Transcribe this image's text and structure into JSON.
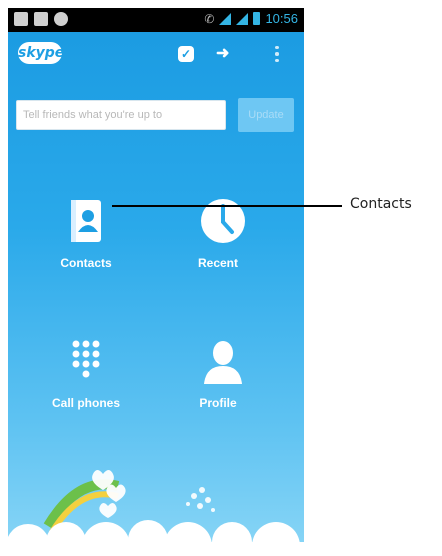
{
  "status_bar": {
    "time": "10:56"
  },
  "app_bar": {
    "logo_text": "skype"
  },
  "mood": {
    "placeholder": "Tell friends what you're up to",
    "button_label": "Update"
  },
  "tiles": [
    {
      "label": "Contacts",
      "icon": "contacts-book-icon"
    },
    {
      "label": "Recent",
      "icon": "clock-icon"
    },
    {
      "label": "Call phones",
      "icon": "dialpad-icon"
    },
    {
      "label": "Profile",
      "icon": "person-icon"
    }
  ],
  "callout": {
    "label": "Contacts"
  },
  "colors": {
    "background_top": "#1a9ae1",
    "background_bottom": "#8ad6f6",
    "status_accent": "#34b5e5"
  }
}
